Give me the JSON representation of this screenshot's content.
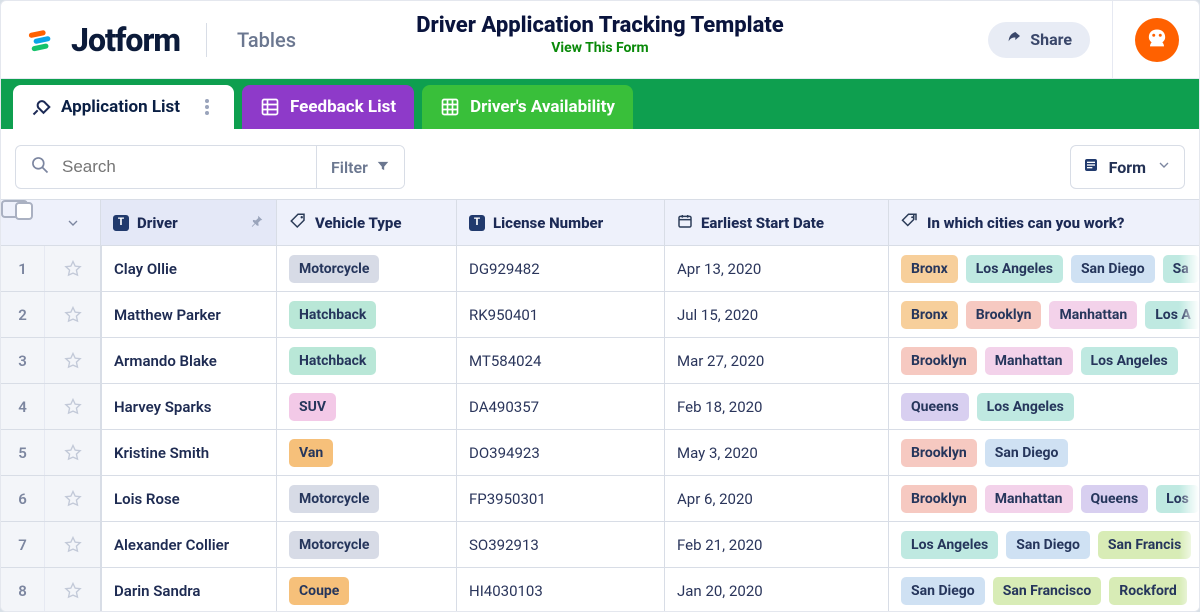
{
  "brand": {
    "name": "Jotform",
    "section": "Tables"
  },
  "header": {
    "title": "Driver Application Tracking Template",
    "view_link": "View This Form",
    "share_label": "Share"
  },
  "tabs": [
    {
      "id": "application-list",
      "label": "Application List",
      "variant": "active"
    },
    {
      "id": "feedback-list",
      "label": "Feedback List",
      "variant": "purple"
    },
    {
      "id": "availability",
      "label": "Driver's Availability",
      "variant": "lime"
    }
  ],
  "toolbar": {
    "search_placeholder": "Search",
    "filter_label": "Filter",
    "view_label": "Form"
  },
  "columns": {
    "driver": "Driver",
    "vehicle": "Vehicle Type",
    "license": "License Number",
    "start": "Earliest Start Date",
    "cities": "In which cities can you work?"
  },
  "vehicle_colors": {
    "Motorcycle": "gray",
    "Hatchback": "mint",
    "SUV": "pink",
    "Van": "orange2",
    "Coupe": "orange2"
  },
  "city_colors": {
    "Bronx": "orange",
    "Los Angeles": "teal",
    "San Diego": "blue",
    "Brooklyn": "rose",
    "Manhattan": "pink2",
    "Queens": "purple",
    "San Francisco": "lime",
    "Rockford": "lime",
    "Los": "teal",
    "Los A": "teal",
    "San Francis": "lime",
    "Sa": "teal"
  },
  "rows": [
    {
      "n": 1,
      "driver": "Clay Ollie",
      "vehicle": "Motorcycle",
      "license": "DG929482",
      "start": "Apr 13, 2020",
      "cities": [
        "Bronx",
        "Los Angeles",
        "San Diego",
        "Sa"
      ]
    },
    {
      "n": 2,
      "driver": "Matthew Parker",
      "vehicle": "Hatchback",
      "license": "RK950401",
      "start": "Jul 15, 2020",
      "cities": [
        "Bronx",
        "Brooklyn",
        "Manhattan",
        "Los A"
      ]
    },
    {
      "n": 3,
      "driver": "Armando Blake",
      "vehicle": "Hatchback",
      "license": "MT584024",
      "start": "Mar 27, 2020",
      "cities": [
        "Brooklyn",
        "Manhattan",
        "Los Angeles"
      ]
    },
    {
      "n": 4,
      "driver": "Harvey Sparks",
      "vehicle": "SUV",
      "license": "DA490357",
      "start": "Feb 18, 2020",
      "cities": [
        "Queens",
        "Los Angeles"
      ]
    },
    {
      "n": 5,
      "driver": "Kristine Smith",
      "vehicle": "Van",
      "license": "DO394923",
      "start": "May 3, 2020",
      "cities": [
        "Brooklyn",
        "San Diego"
      ]
    },
    {
      "n": 6,
      "driver": "Lois Rose",
      "vehicle": "Motorcycle",
      "license": "FP3950301",
      "start": "Apr 6, 2020",
      "cities": [
        "Brooklyn",
        "Manhattan",
        "Queens",
        "Los"
      ]
    },
    {
      "n": 7,
      "driver": "Alexander Collier",
      "vehicle": "Motorcycle",
      "license": "SO392913",
      "start": "Feb 21, 2020",
      "cities": [
        "Los Angeles",
        "San Diego",
        "San Francis"
      ]
    },
    {
      "n": 8,
      "driver": "Darin Sandra",
      "vehicle": "Coupe",
      "license": "HI4030103",
      "start": "Jan 20, 2020",
      "cities": [
        "San Diego",
        "San Francisco",
        "Rockford"
      ]
    }
  ]
}
